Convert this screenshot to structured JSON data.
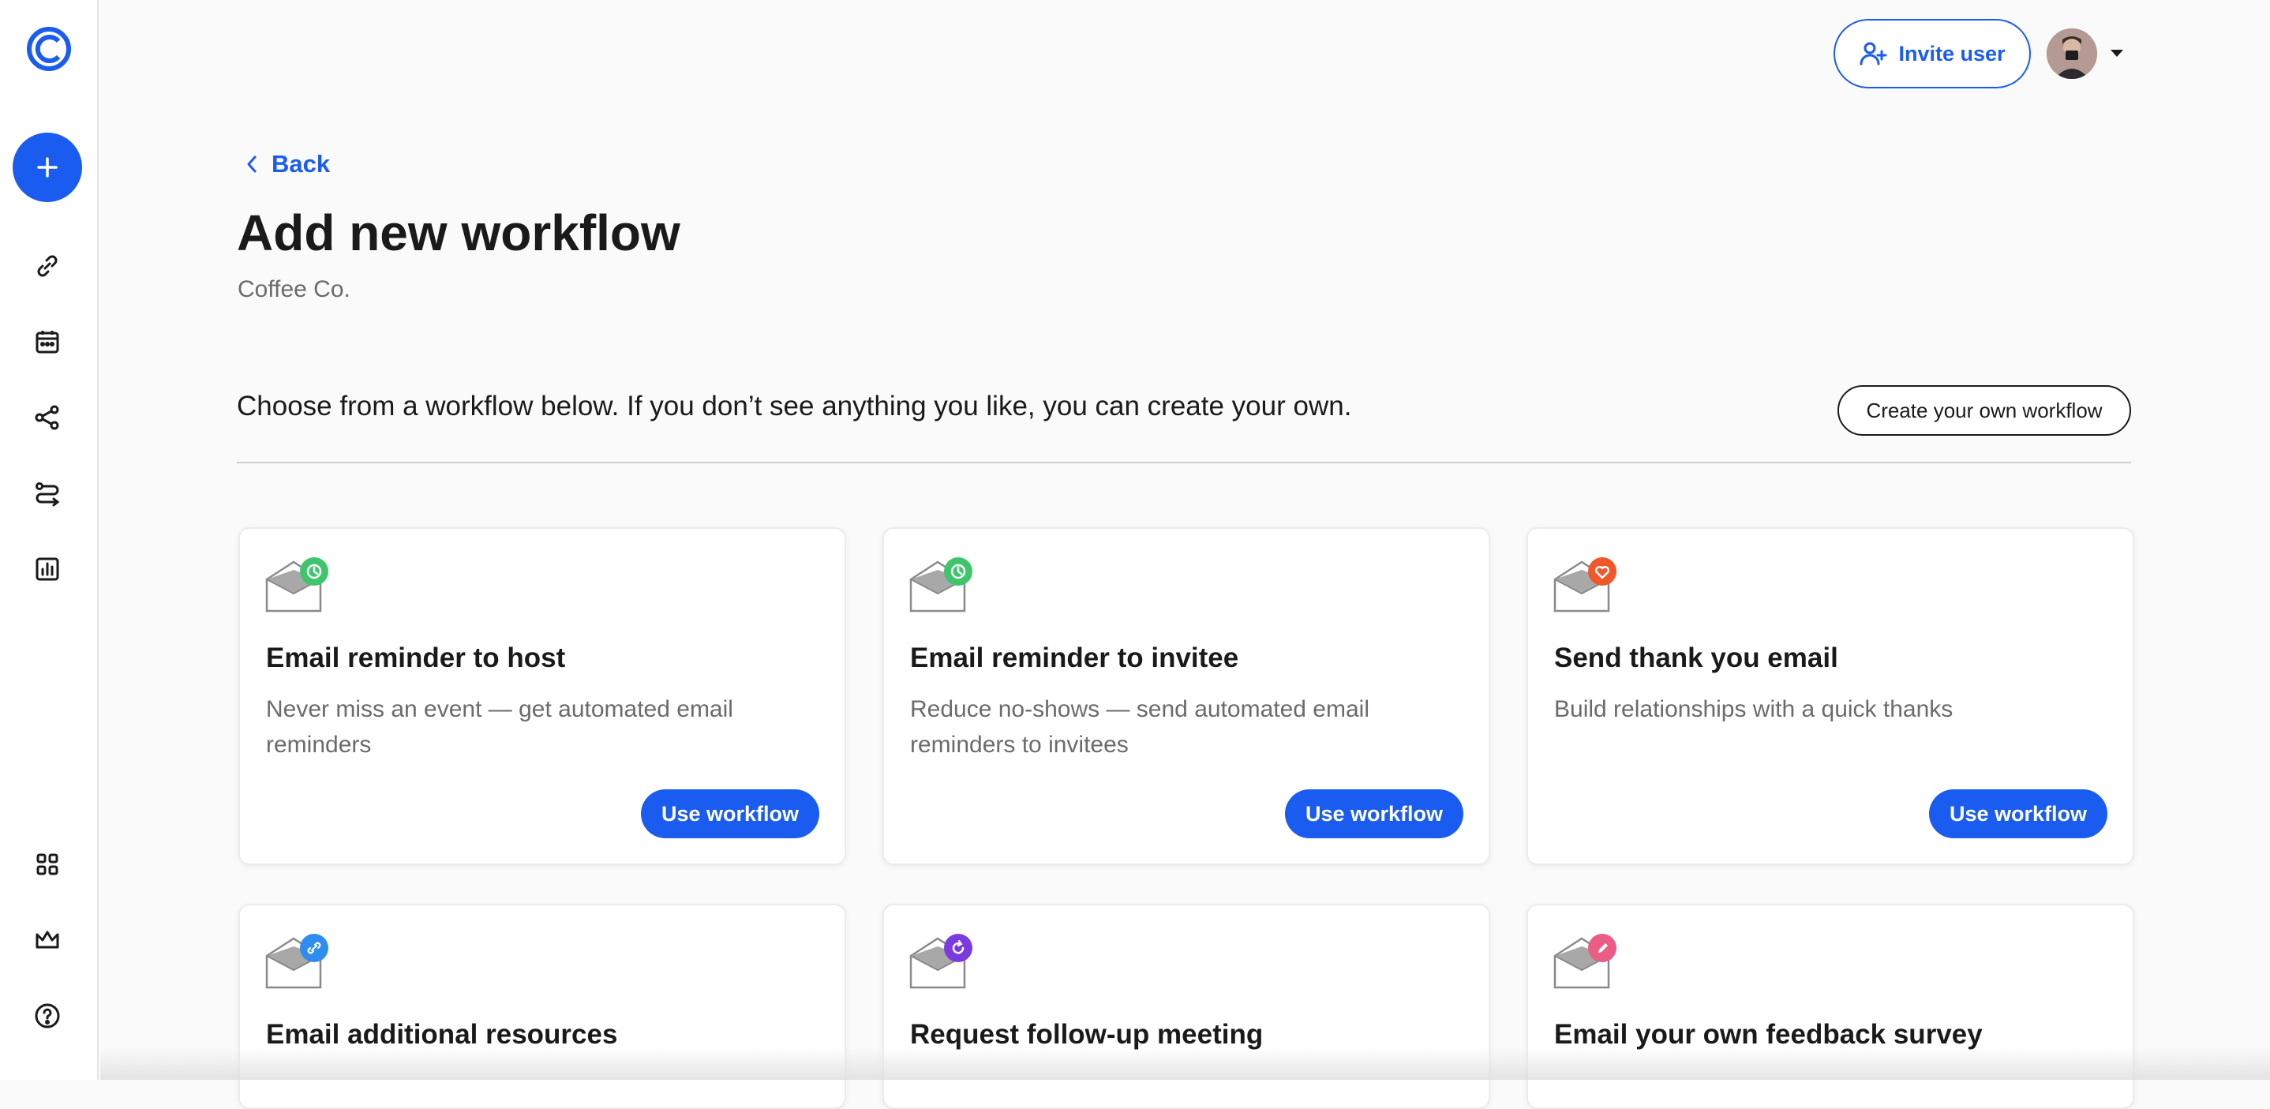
{
  "header": {
    "invite_label": "Invite user"
  },
  "nav": {
    "back_label": "Back"
  },
  "page": {
    "title": "Add new workflow",
    "subtitle": "Coffee Co.",
    "intro": "Choose from a workflow below. If you don’t see anything you like, you can create your own.",
    "create_own_label": "Create your own workflow"
  },
  "sidebar": {
    "items": [
      {
        "icon": "link-icon"
      },
      {
        "icon": "calendar-icon"
      },
      {
        "icon": "share-nodes-icon"
      },
      {
        "icon": "routing-icon"
      },
      {
        "icon": "analytics-icon"
      },
      {
        "icon": "apps-grid-icon"
      },
      {
        "icon": "crown-icon"
      },
      {
        "icon": "help-icon"
      }
    ]
  },
  "workflows": [
    {
      "title": "Email reminder to host",
      "desc": "Never miss an event — get automated email reminders",
      "button": "Use workflow",
      "badge": "clock-icon",
      "badge_color": "#3fc56b"
    },
    {
      "title": "Email reminder to invitee",
      "desc": "Reduce no-shows — send automated email reminders to invitees",
      "button": "Use workflow",
      "badge": "clock-icon",
      "badge_color": "#3fc56b"
    },
    {
      "title": "Send thank you email",
      "desc": "Build relationships with a quick thanks",
      "button": "Use workflow",
      "badge": "heart-icon",
      "badge_color": "#f0582a"
    },
    {
      "title": "Email additional resources",
      "desc": "",
      "button": "",
      "badge": "link-icon",
      "badge_color": "#2f8cf0"
    },
    {
      "title": "Request follow-up meeting",
      "desc": "",
      "button": "",
      "badge": "refresh-icon",
      "badge_color": "#7b3ae0"
    },
    {
      "title": "Email your own feedback survey",
      "desc": "",
      "button": "",
      "badge": "pencil-icon",
      "badge_color": "#ec5d86"
    }
  ],
  "colors": {
    "accent": "#1b5cf0",
    "text": "#1a1a1a",
    "muted": "#6b6b6b"
  }
}
